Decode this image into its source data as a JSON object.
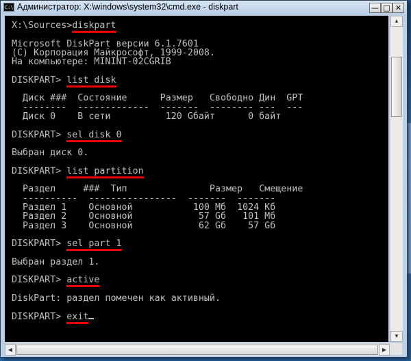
{
  "window": {
    "title": "Администратор: X:\\windows\\system32\\cmd.exe - diskpart",
    "icon_label": "C:\\",
    "min_glyph": "—",
    "max_glyph": "□",
    "close_glyph": "✕"
  },
  "console": {
    "lines": [
      {
        "text": "X:\\Sources>",
        "cmd": "diskpart"
      },
      {
        "text": ""
      },
      {
        "text": "Microsoft DiskPart версии 6.1.7601"
      },
      {
        "text": "(C) Корпорация Майкрософт, 1999-2008."
      },
      {
        "text": "На компьютере: MININT-02CGRIB"
      },
      {
        "text": ""
      },
      {
        "text": "DISKPART> ",
        "cmd": "list disk"
      },
      {
        "text": ""
      },
      {
        "text": "  Диск ###  Состояние      Размер   Свободно Дин  GPT"
      },
      {
        "text": "  --------  -------------  -------  -------- ---  ---"
      },
      {
        "text": "  Диск 0    В сети          120 Gбайт      0 байт"
      },
      {
        "text": ""
      },
      {
        "text": "DISKPART> ",
        "cmd": "sel disk 0"
      },
      {
        "text": ""
      },
      {
        "text": "Выбран диск 0."
      },
      {
        "text": ""
      },
      {
        "text": "DISKPART> ",
        "cmd": "list partition"
      },
      {
        "text": ""
      },
      {
        "text": "  Раздел     ###  Тип               Размер   Смещение"
      },
      {
        "text": "  ----------  ----------------  -------  -------"
      },
      {
        "text": "  Раздел 1    Основной           100 Mб  1024 Kб"
      },
      {
        "text": "  Раздел 2    Основной            57 Gб   101 Mб"
      },
      {
        "text": "  Раздел 3    Основной            62 Gб    57 Gб"
      },
      {
        "text": ""
      },
      {
        "text": "DISKPART> ",
        "cmd": "sel part 1"
      },
      {
        "text": ""
      },
      {
        "text": "Выбран раздел 1."
      },
      {
        "text": ""
      },
      {
        "text": "DISKPART> ",
        "cmd": "active"
      },
      {
        "text": ""
      },
      {
        "text": "DiskPart: раздел помечен как активный."
      },
      {
        "text": ""
      },
      {
        "text": "DISKPART> ",
        "cmd": "exit",
        "cursor": true
      }
    ]
  },
  "colors": {
    "console_bg": "#000000",
    "console_fg": "#c0c0c0",
    "highlight_underline": "#ee0000"
  },
  "scrollbars": {
    "up_glyph": "▲",
    "down_glyph": "▼",
    "left_glyph": "◀",
    "right_glyph": "▶"
  }
}
